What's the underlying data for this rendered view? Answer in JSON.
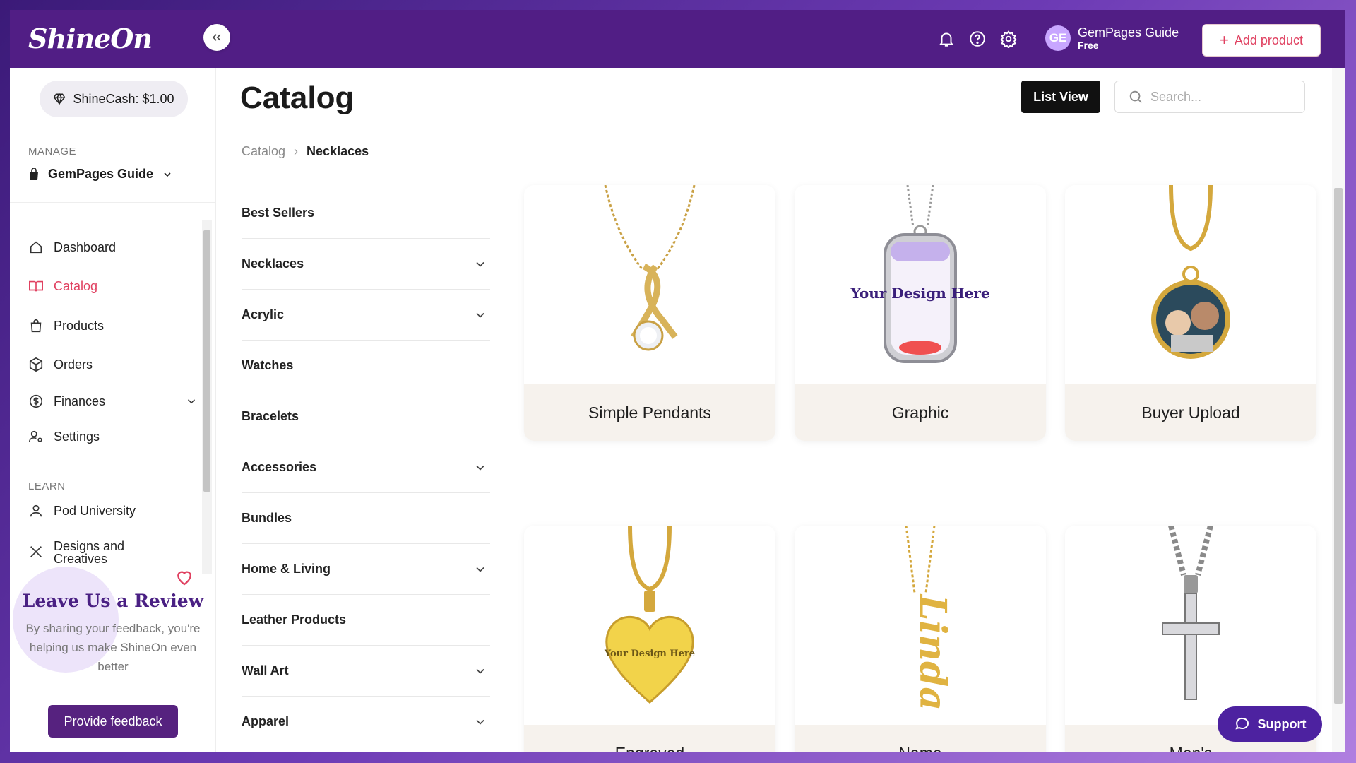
{
  "header": {
    "logo": "ShineOn",
    "user": {
      "initials": "GE",
      "name": "GemPages Guide",
      "plan": "Free"
    },
    "add_product_label": "Add product"
  },
  "sidebar": {
    "shinecash": "ShineCash: $1.00",
    "manage_label": "MANAGE",
    "store_name": "GemPages Guide",
    "nav": [
      {
        "label": "Dashboard",
        "icon": "home-icon"
      },
      {
        "label": "Catalog",
        "icon": "book-icon",
        "active": true
      },
      {
        "label": "Products",
        "icon": "shopping-bag-icon"
      },
      {
        "label": "Orders",
        "icon": "box-icon"
      },
      {
        "label": "Finances",
        "icon": "dollar-icon"
      },
      {
        "label": "Settings",
        "icon": "user-gear-icon"
      }
    ],
    "learn_label": "LEARN",
    "learn_nav": [
      {
        "label": "Pod University",
        "icon": "graduate-icon"
      },
      {
        "label": "Designs and Creatives",
        "icon": "tools-icon"
      }
    ],
    "review": {
      "title": "Leave Us a Review",
      "text": "By sharing your feedback, you're helping us make ShineOn even better",
      "button": "Provide feedback"
    }
  },
  "main": {
    "title": "Catalog",
    "list_view_label": "List View",
    "search_placeholder": "Search...",
    "breadcrumb": [
      "Catalog",
      "Necklaces"
    ],
    "categories": [
      {
        "label": "Best Sellers",
        "expandable": false
      },
      {
        "label": "Necklaces",
        "expandable": true
      },
      {
        "label": "Acrylic",
        "expandable": true
      },
      {
        "label": "Watches",
        "expandable": false
      },
      {
        "label": "Bracelets",
        "expandable": false
      },
      {
        "label": "Accessories",
        "expandable": true
      },
      {
        "label": "Bundles",
        "expandable": false
      },
      {
        "label": "Home & Living",
        "expandable": true
      },
      {
        "label": "Leather Products",
        "expandable": false
      },
      {
        "label": "Wall Art",
        "expandable": true
      },
      {
        "label": "Apparel",
        "expandable": true
      }
    ],
    "cards": [
      {
        "label": "Simple Pendants"
      },
      {
        "label": "Graphic",
        "image_text": "Your Design Here"
      },
      {
        "label": "Buyer Upload"
      },
      {
        "label": "Engraved",
        "image_text": "Your Design Here"
      },
      {
        "label": "Name",
        "image_text": "Linda"
      },
      {
        "label": "Men's"
      }
    ]
  },
  "support_label": "Support",
  "colors": {
    "header": "#511e85",
    "accent": "#e04060",
    "feedback": "#56227f",
    "support": "#4d22a0"
  }
}
